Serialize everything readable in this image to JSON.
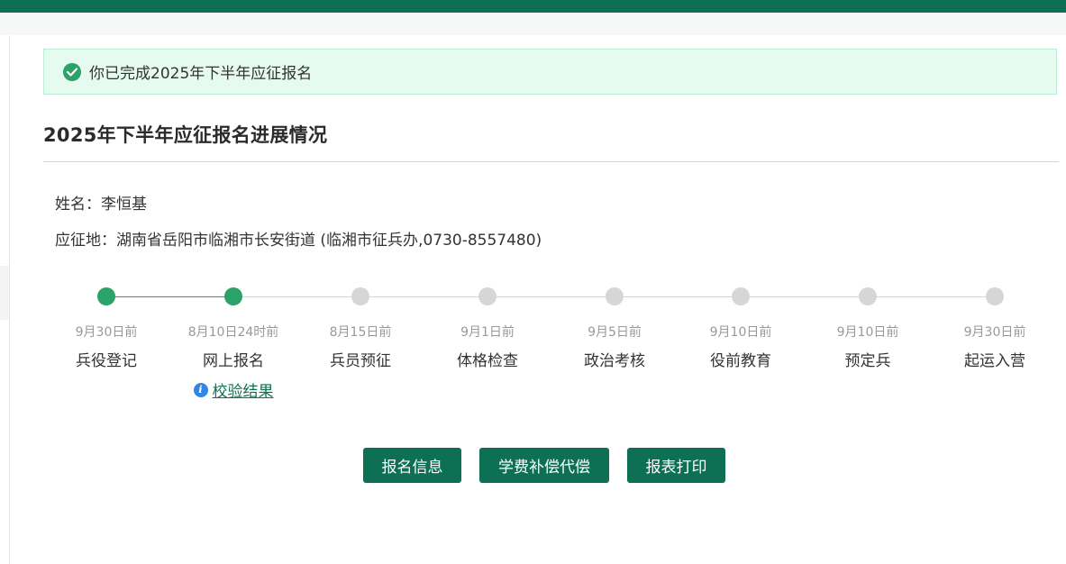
{
  "alert": {
    "message": "你已完成2025年下半年应征报名",
    "icon": "check-circle-icon"
  },
  "page": {
    "title": "2025年下半年应征报名进展情况"
  },
  "info": {
    "name_label": "姓名：",
    "name_value": "李恒基",
    "place_label": "应征地：",
    "place_value": "湖南省岳阳市临湘市长安街道 (临湘市征兵办,0730-8557480)"
  },
  "timeline": {
    "completed_count": 2,
    "steps": [
      {
        "date": "9月30日前",
        "label": "兵役登记",
        "done": true
      },
      {
        "date": "8月10日24时前",
        "label": "网上报名",
        "done": true,
        "link": "校验结果"
      },
      {
        "date": "8月15日前",
        "label": "兵员预征",
        "done": false
      },
      {
        "date": "9月1日前",
        "label": "体格检查",
        "done": false
      },
      {
        "date": "9月5日前",
        "label": "政治考核",
        "done": false
      },
      {
        "date": "9月10日前",
        "label": "役前教育",
        "done": false
      },
      {
        "date": "9月10日前",
        "label": "预定兵",
        "done": false
      },
      {
        "date": "9月30日前",
        "label": "起运入营",
        "done": false
      }
    ]
  },
  "actions": {
    "signup_info": "报名信息",
    "tuition": "学费补偿代偿",
    "print": "报表打印"
  },
  "colors": {
    "brand": "#0d7055",
    "done": "#2aa26a",
    "pending": "#d6d6d6"
  }
}
